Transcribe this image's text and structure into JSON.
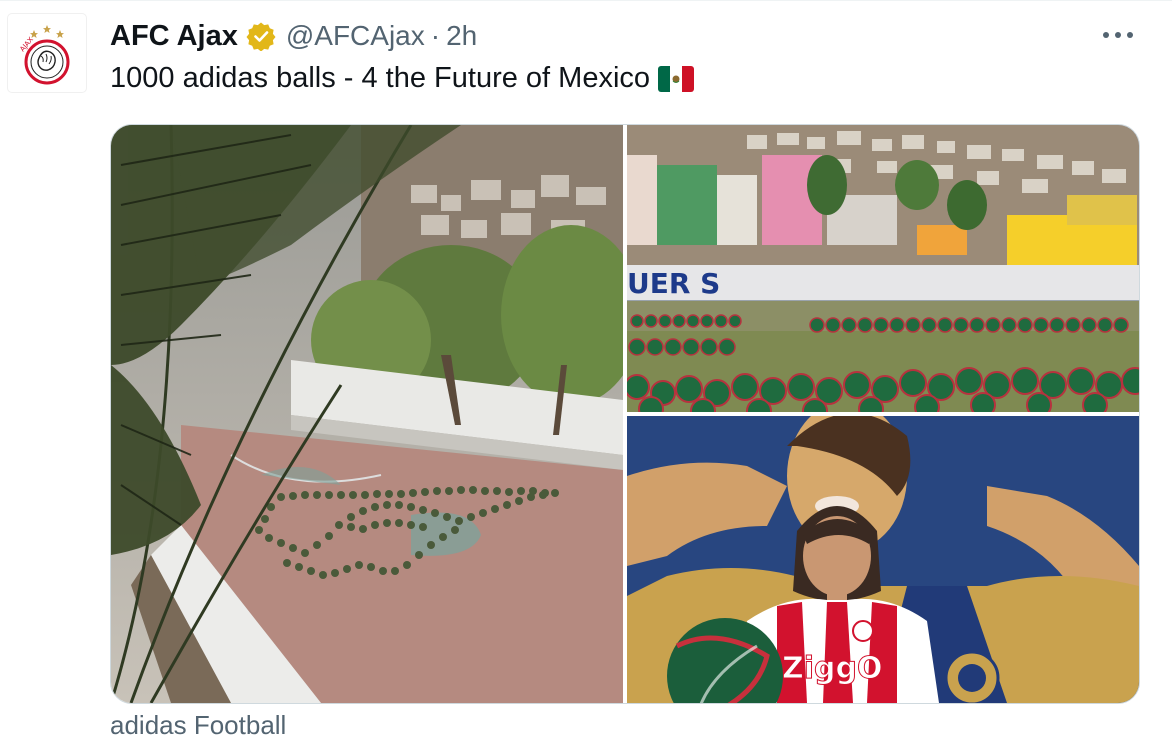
{
  "tweet": {
    "author_name": "AFC Ajax",
    "handle": "@AFCAjax",
    "separator": "·",
    "time": "2h",
    "text": "1000 adidas balls - 4 the Future of Mexico",
    "flag_icon": "mexico-flag-icon",
    "verified_icon": "verified-gold-badge-icon",
    "more_icon": "more-options-icon"
  },
  "media": {
    "wall_text": "UER S",
    "shirt_sponsor": "ZiggO"
  },
  "source_label": "adidas Football",
  "colors": {
    "text_primary": "#0f1419",
    "text_secondary": "#536471",
    "border": "#cfd9de",
    "ajax_red": "#d2122e",
    "verified_gold": "#e2b719"
  }
}
